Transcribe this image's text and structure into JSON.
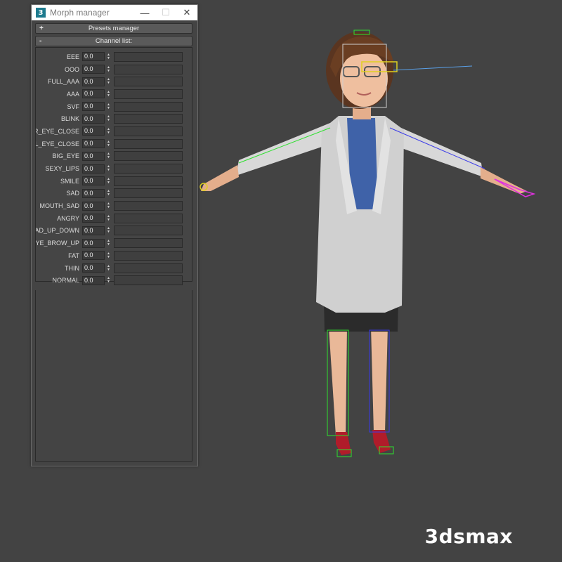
{
  "window": {
    "title": "Morph manager",
    "app_icon_glyph": "3",
    "controls": {
      "minimize": "—",
      "maximize": "☐",
      "close": "✕"
    }
  },
  "rollouts": {
    "presets": {
      "sign": "+",
      "label": "Presets manager"
    },
    "channels": {
      "sign": "-",
      "label": "Channel list:"
    }
  },
  "channels": [
    {
      "name": "EEE",
      "value": "0.0"
    },
    {
      "name": "OOO",
      "value": "0.0"
    },
    {
      "name": "FULL_AAA",
      "value": "0.0"
    },
    {
      "name": "AAA",
      "value": "0.0"
    },
    {
      "name": "SVF",
      "value": "0.0"
    },
    {
      "name": "BLINK",
      "value": "0.0"
    },
    {
      "name": "R_EYE_CLOSE",
      "value": "0.0"
    },
    {
      "name": "L_EYE_CLOSE",
      "value": "0.0"
    },
    {
      "name": "BIG_EYE",
      "value": "0.0"
    },
    {
      "name": "SEXY_LIPS",
      "value": "0.0"
    },
    {
      "name": "SMILE",
      "value": "0.0"
    },
    {
      "name": "SAD",
      "value": "0.0"
    },
    {
      "name": "MOUTH_SAD",
      "value": "0.0"
    },
    {
      "name": "ANGRY",
      "value": "0.0"
    },
    {
      "name": "EAD_UP_DOWN",
      "value": "0.0"
    },
    {
      "name": "EYE_BROW_UP",
      "value": "0.0"
    },
    {
      "name": "FAT",
      "value": "0.0"
    },
    {
      "name": "THIN",
      "value": "0.0"
    },
    {
      "name": "NORMAL",
      "value": "0.0"
    }
  ],
  "watermark": "3dsmax",
  "colors": {
    "viewport_bg": "#434343",
    "app_icon": "#1e7b8e",
    "rig_green": "#2ee02e",
    "rig_blue": "#3a3ae8",
    "rig_magenta": "#e030e0"
  }
}
